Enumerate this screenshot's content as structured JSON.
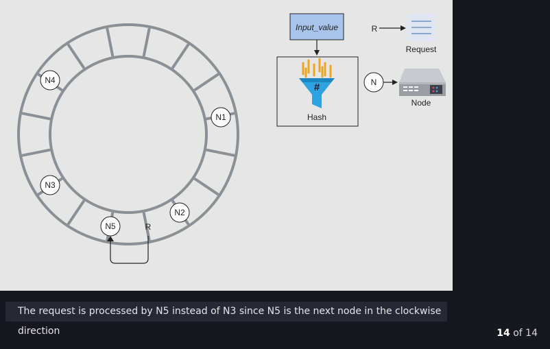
{
  "nodes": {
    "n1": "N1",
    "n2": "N2",
    "n3": "N3",
    "n4": "N4",
    "n5": "N5"
  },
  "request_marker": "R",
  "hash_box": {
    "input_label": "Input_value",
    "hash_label": "Hash"
  },
  "legend": {
    "request_key": "R",
    "request_label": "Request",
    "node_key": "N",
    "node_label": "Node"
  },
  "icons": {
    "hash": "funnel-hash-icon",
    "request": "document-lines-icon",
    "node": "server-icon"
  },
  "caption": "The request is processed by N5 instead of N3 since N5 is the next node in the clockwise direction",
  "pager": {
    "current": "14",
    "of_label": "of",
    "total": "14"
  }
}
